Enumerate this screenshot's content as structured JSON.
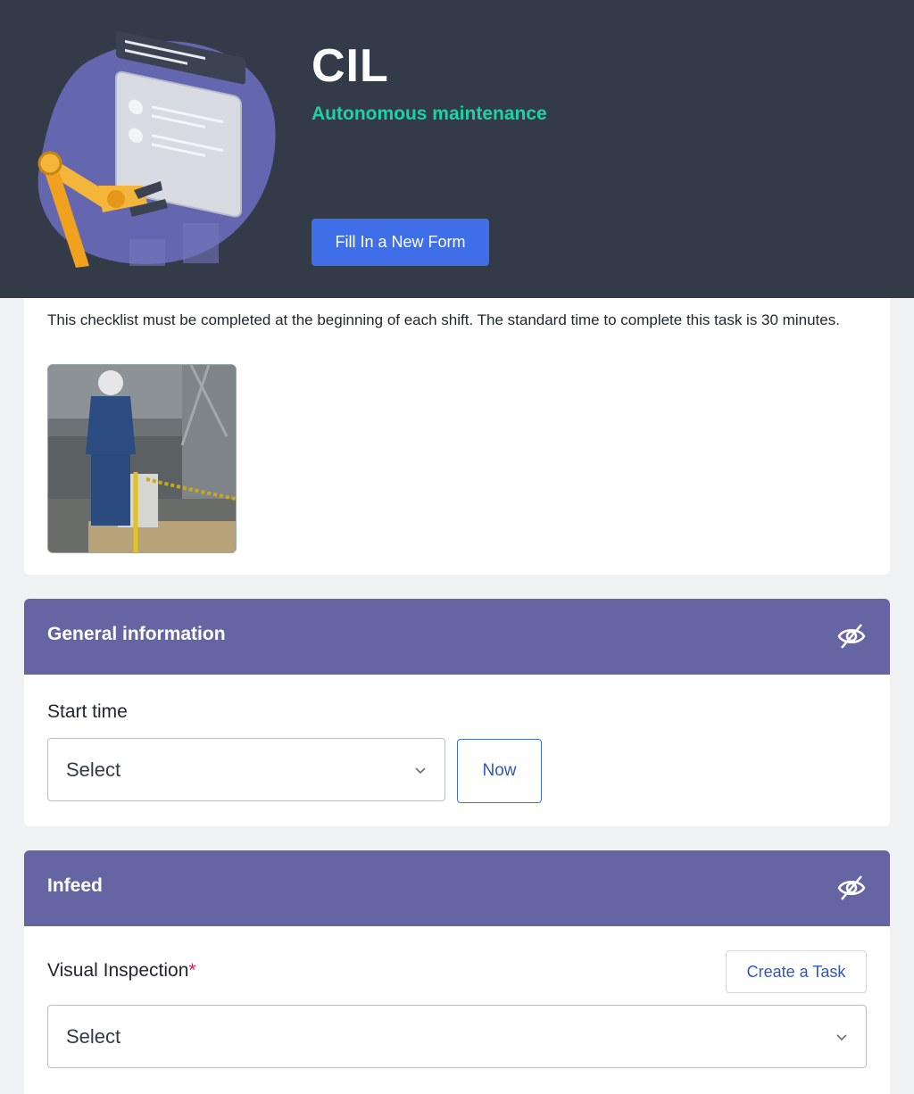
{
  "header": {
    "title": "CIL",
    "subtitle": "Autonomous maintenance",
    "fill_button_label": "Fill In a New Form"
  },
  "intro": {
    "description": "This checklist must be completed at the beginning of each shift. The standard time to complete this task is 30 minutes.",
    "photo": "photo-worker-at-machine"
  },
  "sections": [
    {
      "title": "General information",
      "visibility_icon": "eye-off-icon",
      "fields": [
        {
          "label": "Start time",
          "required": false,
          "value": "Select",
          "action_label": "Now"
        }
      ]
    },
    {
      "title": "Infeed",
      "visibility_icon": "eye-off-icon",
      "fields": [
        {
          "label": "Visual Inspection",
          "required": true,
          "required_mark": "*",
          "value": "Select",
          "action_label": "Create a Task"
        }
      ]
    }
  ],
  "colors": {
    "header_bg": "#333a48",
    "accent_green": "#1fd1a6",
    "primary_blue": "#3f6fe8",
    "section_purple": "#6565a3",
    "required_red": "#d6225b"
  }
}
